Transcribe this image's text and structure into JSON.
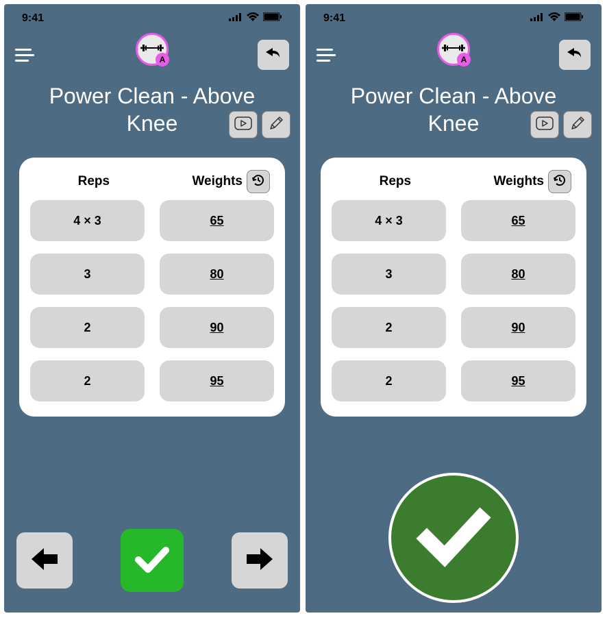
{
  "statusbar": {
    "time": "9:41"
  },
  "logo": {
    "badge_letter": "A"
  },
  "exercise": {
    "title": "Power Clean - Above Knee"
  },
  "table": {
    "headers": {
      "reps": "Reps",
      "weights": "Weights"
    },
    "rows": [
      {
        "reps": "4 × 3",
        "weight": "65"
      },
      {
        "reps": "3",
        "weight": "80"
      },
      {
        "reps": "2",
        "weight": "90"
      },
      {
        "reps": "2",
        "weight": "95"
      }
    ]
  }
}
